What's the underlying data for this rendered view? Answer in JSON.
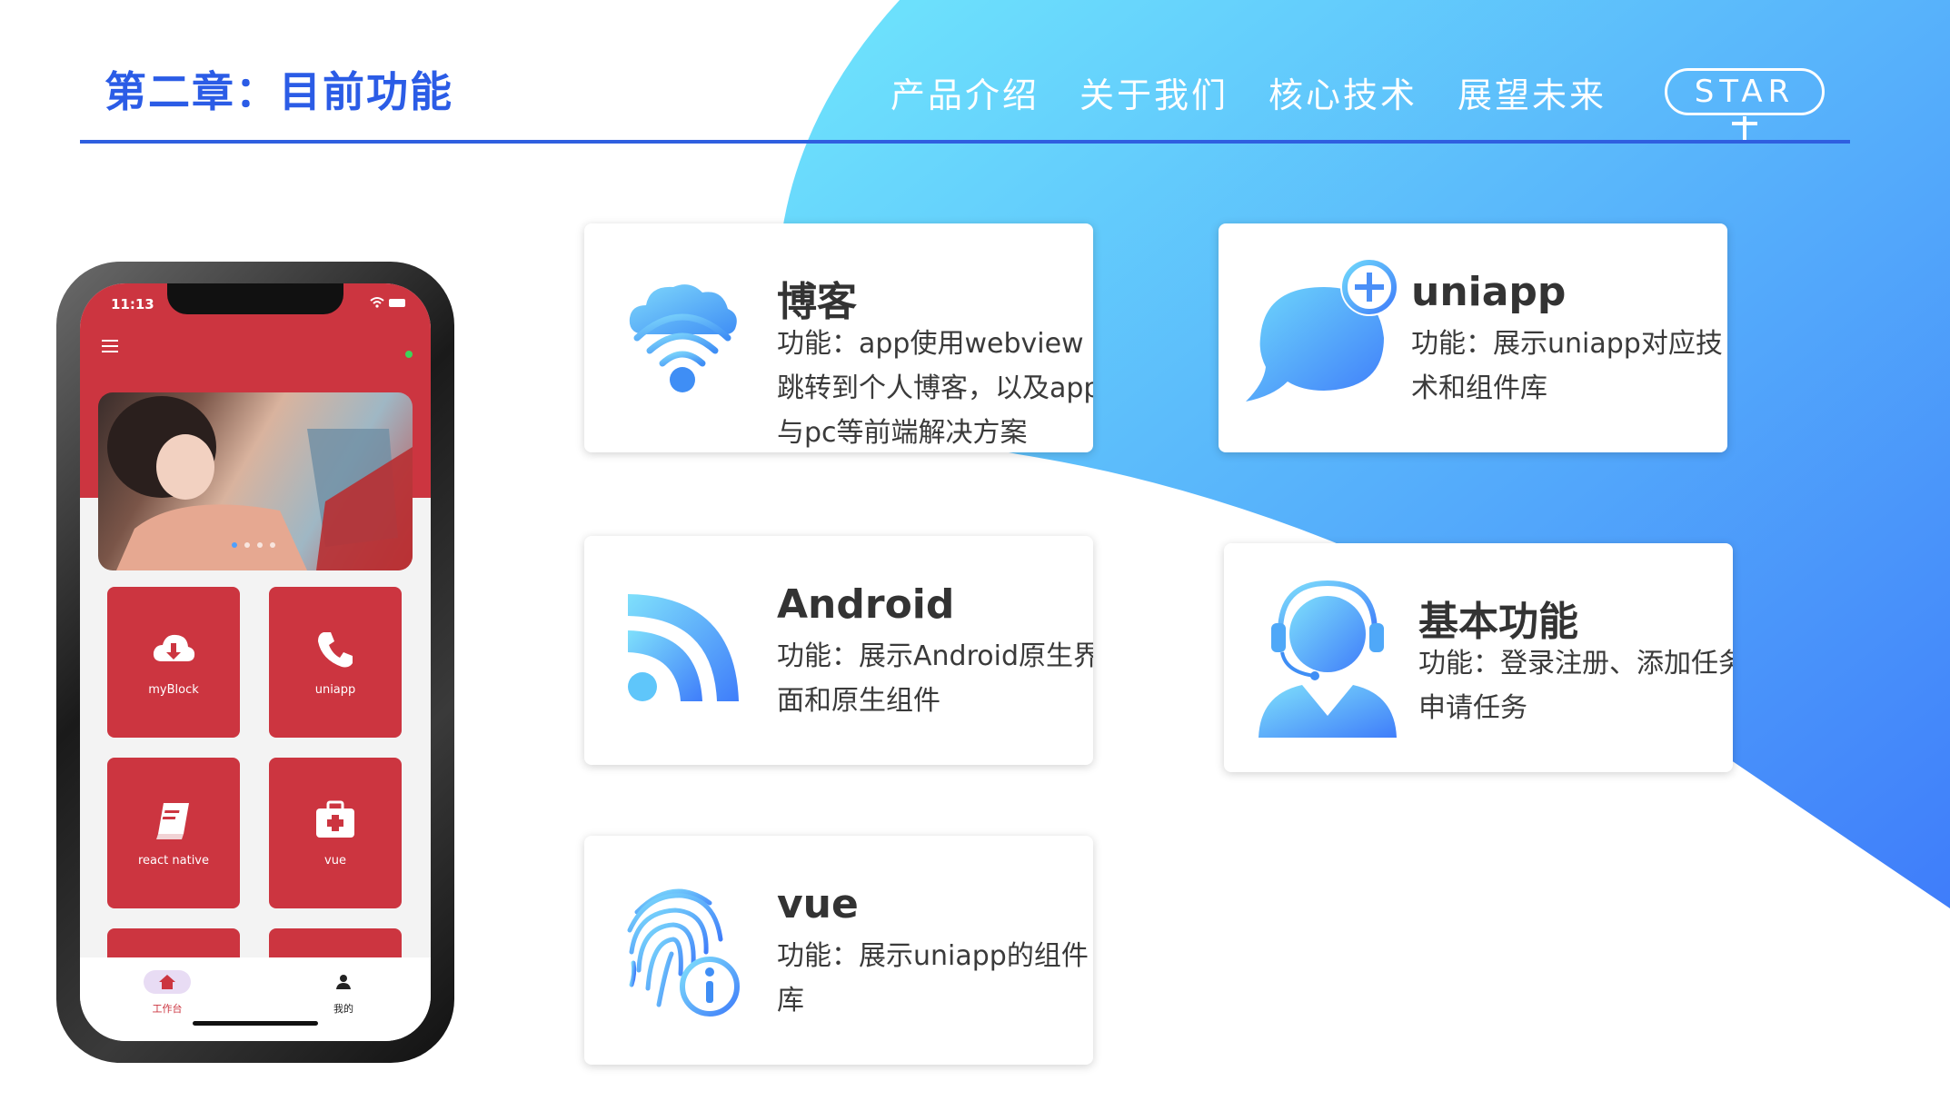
{
  "header": {
    "title": "第二章：目前功能",
    "nav": [
      "产品介绍",
      "关于我们",
      "核心技术",
      "展望未来"
    ],
    "star_label": "STAR"
  },
  "cards": [
    {
      "title": "博客",
      "description": "功能：app使用webview跳转到个人博客，以及app与pc等前端解决方案",
      "icon": "cloud-wifi-icon"
    },
    {
      "title": "uniapp",
      "description": "功能：展示uniapp对应技术和组件库",
      "icon": "chat-bubble-plus-icon"
    },
    {
      "title": "Android",
      "description": "功能：展示Android原生界面和原生组件",
      "icon": "rss-feed-icon"
    },
    {
      "title": "基本功能",
      "description": "功能：登录注册、添加任务申请任务",
      "icon": "customer-service-icon"
    },
    {
      "title": "vue",
      "description": "功能：展示uniapp的组件库",
      "icon": "fingerprint-info-icon"
    }
  ],
  "phone": {
    "status_time": "11:13",
    "tiles": [
      {
        "label": "myBlock",
        "icon": "cloud-download-icon"
      },
      {
        "label": "uniapp",
        "icon": "phone-icon"
      },
      {
        "label": "react native",
        "icon": "book-icon"
      },
      {
        "label": "vue",
        "icon": "medkit-icon"
      }
    ],
    "tabs": [
      {
        "label": "工作台",
        "icon": "home-icon",
        "active": true
      },
      {
        "label": "我的",
        "icon": "user-icon",
        "active": false
      }
    ]
  },
  "colors": {
    "accent": "#2b5ce6",
    "gradient_start": "#6fe6fc",
    "gradient_end": "#3f7dfa",
    "phone_red": "#cc3540"
  }
}
